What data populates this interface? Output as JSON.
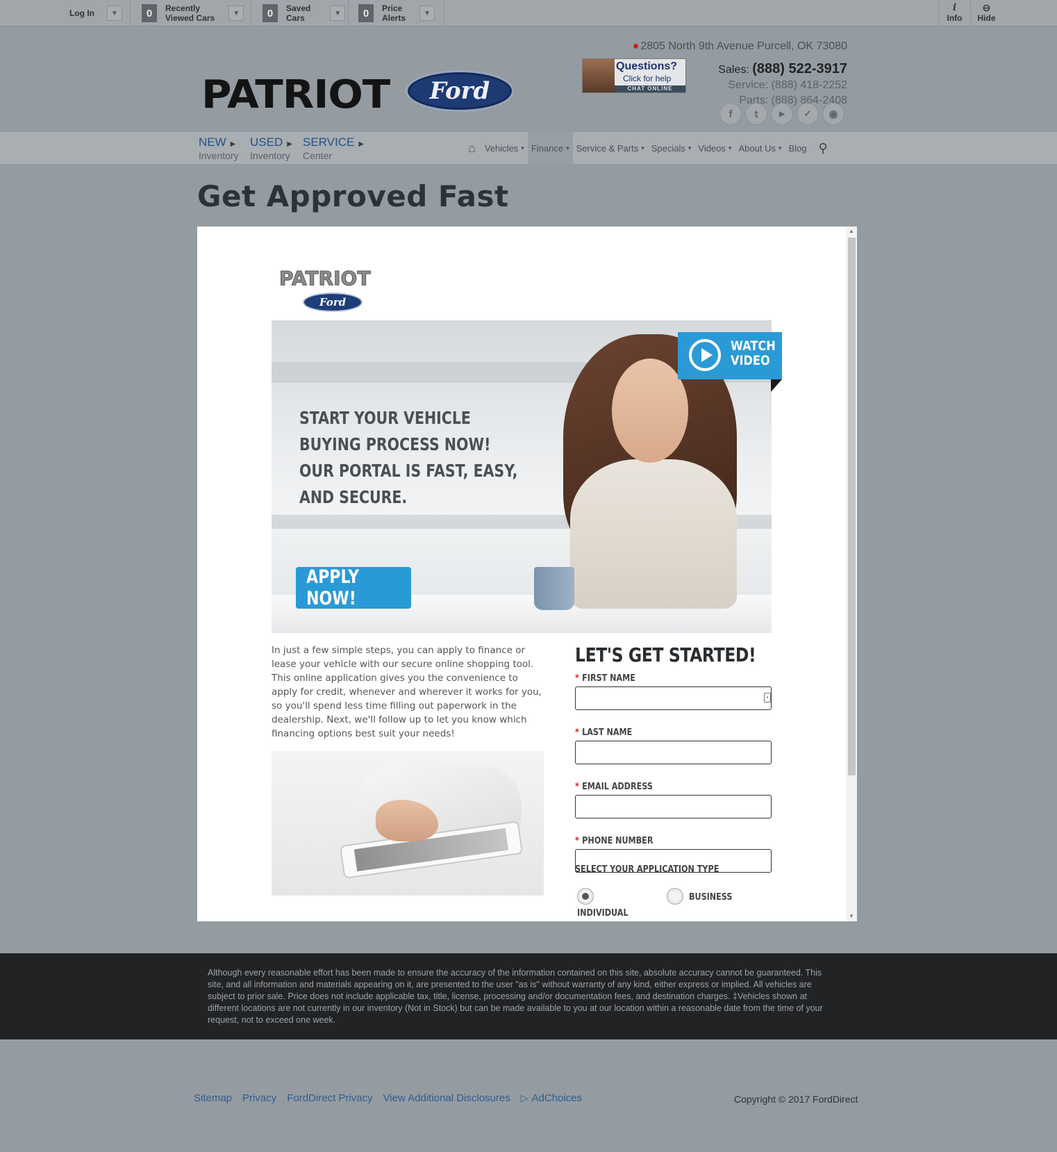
{
  "toolbar": {
    "login": "Log In",
    "recently_viewed": {
      "count": "0",
      "line1": "Recently",
      "line2": "Viewed Cars"
    },
    "saved": {
      "count": "0",
      "line1": "Saved",
      "line2": "Cars"
    },
    "alerts": {
      "count": "0",
      "line1": "Price",
      "line2": "Alerts"
    },
    "info": "Info",
    "hide": "Hide"
  },
  "header": {
    "dealer_name": "PATRIOT",
    "brand": "Ford",
    "address": "2805 North 9th Avenue Purcell, OK 73080",
    "chat": {
      "title": "Questions?",
      "subtitle": "Click for help",
      "cta": "CHAT ONLINE"
    },
    "sales_label": "Sales:",
    "sales_phone": "(888) 522-3917",
    "service": "Service: (888) 418-2252",
    "parts": "Parts: (888) 864-2408",
    "social_icons": [
      "facebook-icon",
      "twitter-icon",
      "youtube-icon",
      "reviews-icon",
      "location-icon"
    ]
  },
  "nav": {
    "quick": [
      {
        "big": "NEW",
        "small": "Inventory"
      },
      {
        "big": "USED",
        "small": "Inventory"
      },
      {
        "big": "SERVICE",
        "small": "Center"
      }
    ],
    "menu": [
      "Vehicles",
      "Finance",
      "Service & Parts",
      "Specials",
      "Videos",
      "About Us",
      "Blog"
    ],
    "active": "Finance"
  },
  "page_title": "Get Approved Fast",
  "panel": {
    "logo_text": "PATRIOT",
    "logo_brand": "Ford",
    "hero_lines": [
      "START YOUR VEHICLE",
      "BUYING PROCESS NOW!",
      "OUR PORTAL IS FAST, EASY,",
      "AND SECURE."
    ],
    "apply_label": "APPLY NOW!",
    "watch_line1": "WATCH",
    "watch_line2": "VIDEO",
    "intro": "In just a few simple steps, you can apply to finance or lease your vehicle with our secure online shopping tool. This online application gives you the convenience to apply for credit, whenever and wherever it works for you, so you'll spend less time filling out paperwork in the dealership. Next, we'll follow up to let you know which financing options best suit your needs!",
    "form_title": "LET'S GET STARTED!",
    "fields": {
      "first_name": "FIRST NAME",
      "last_name": "LAST NAME",
      "email": "EMAIL ADDRESS",
      "phone": "PHONE NUMBER"
    },
    "required_mark": "*",
    "app_type_label": "SELECT YOUR APPLICATION TYPE",
    "app_type_options": [
      "INDIVIDUAL",
      "BUSINESS"
    ],
    "app_type_selected": "INDIVIDUAL"
  },
  "disclaimer": "Although every reasonable effort has been made to ensure the accuracy of the information contained on this site, absolute accuracy cannot be guaranteed. This site, and all information and materials appearing on it, are presented to the user \"as is\" without warranty of any kind, either express or implied. All vehicles are subject to prior sale. Price does not include applicable tax, title, license, processing and/or documentation fees, and destination charges. ‡Vehicles shown at different locations are not currently in our inventory (Not in Stock) but can be made available to you at our location within a reasonable date from the time of your request, not to exceed one week.",
  "footer": {
    "links": [
      "Sitemap",
      "Privacy",
      "FordDirect Privacy",
      "View Additional Disclosures",
      "AdChoices"
    ],
    "copyright": "Copyright © 2017 FordDirect"
  },
  "colors": {
    "accent_blue": "#2a9ad6",
    "link_blue": "#2f5b8f",
    "required_red": "#d2232a"
  }
}
